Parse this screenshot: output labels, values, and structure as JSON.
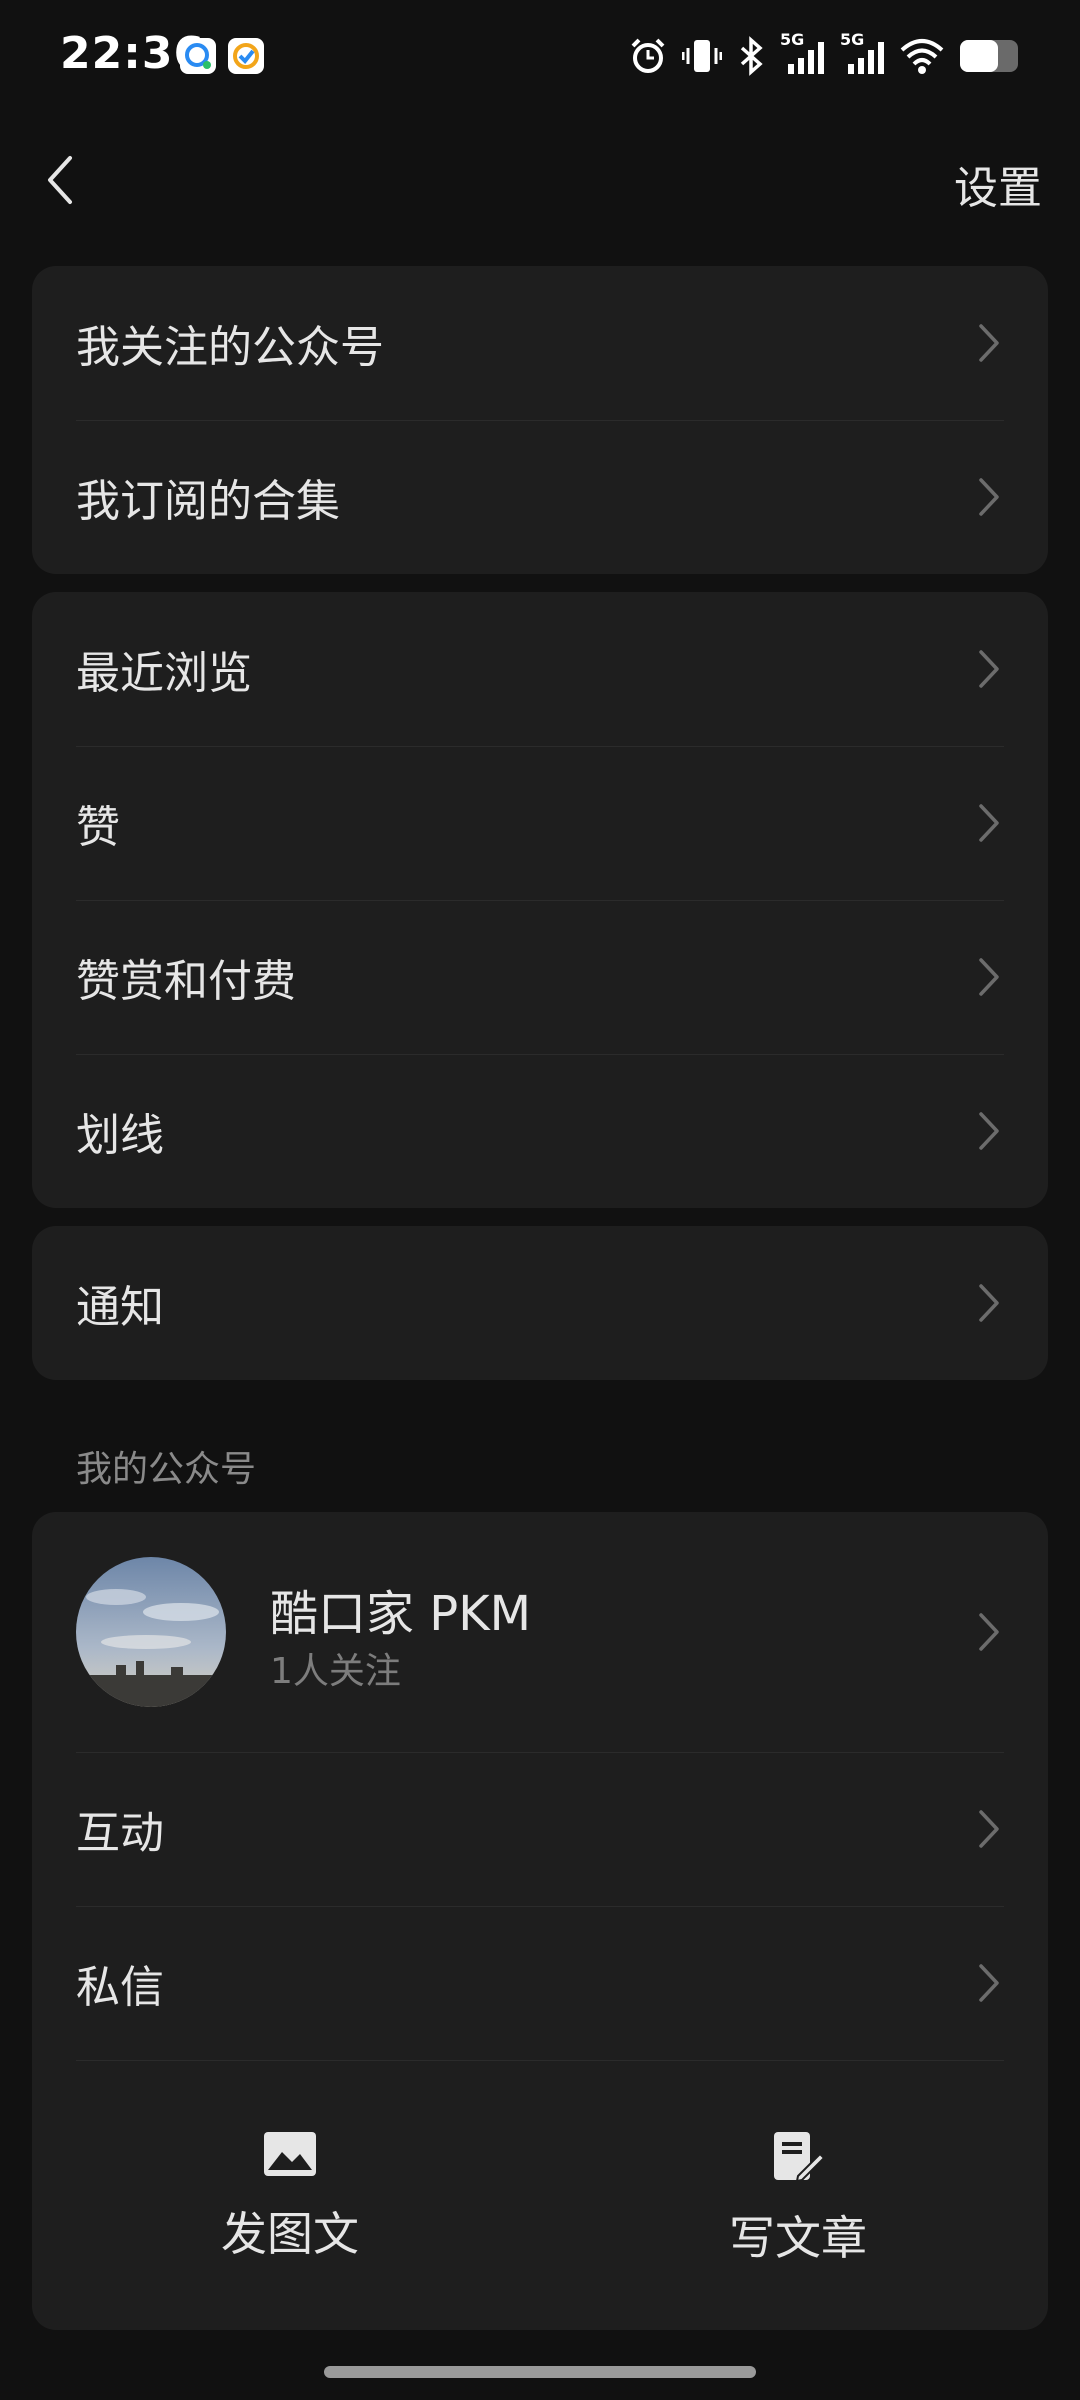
{
  "status_bar": {
    "time": "22:36",
    "icons": [
      "app-icon-1",
      "app-icon-2",
      "alarm-icon",
      "vibrate-icon",
      "bluetooth-icon",
      "signal-5g-icon",
      "signal-5g-icon",
      "wifi-icon",
      "battery-icon"
    ],
    "network_label_1": "5G",
    "network_label_2": "5G"
  },
  "nav": {
    "back_icon": "chevron-left-icon",
    "settings_label": "设置"
  },
  "group1": [
    {
      "label": "我关注的公众号"
    },
    {
      "label": "我订阅的合集"
    }
  ],
  "group2": [
    {
      "label": "最近浏览"
    },
    {
      "label": "赞"
    },
    {
      "label": "赞赏和付费"
    },
    {
      "label": "划线"
    }
  ],
  "group3": [
    {
      "label": "通知"
    }
  ],
  "my_accounts": {
    "section_title": "我的公众号",
    "account": {
      "name": "酷口家 PKM",
      "followers": "1人关注"
    },
    "items": [
      {
        "label": "互动"
      },
      {
        "label": "私信"
      }
    ],
    "actions": [
      {
        "label": "发图文",
        "icon": "image-icon"
      },
      {
        "label": "写文章",
        "icon": "edit-document-icon"
      }
    ]
  },
  "colors": {
    "background": "#111111",
    "card": "#1e1e1e",
    "text": "#e6e6e6",
    "secondary_text": "#8a8a8a"
  }
}
